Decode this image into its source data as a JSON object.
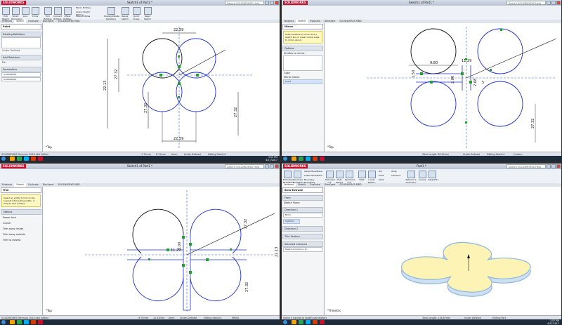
{
  "app": {
    "logo": "SOLIDWORKS",
    "search_placeholder": "Search SOLIDWORKS Help"
  },
  "q1": {
    "title": "Sketch1 of Part1 *",
    "ribbon": [
      "Exit Sketch",
      "Smart Dimension",
      "Line",
      "Circle",
      "Trim Entities",
      "Convert Entities",
      "Offset Entities",
      "Mirror Entities",
      "Linear Sketch Pattern",
      "Move Entities",
      "Display/Delete Relations",
      "Repair Sketch",
      "Quick Snaps",
      "Rapid Sketch"
    ],
    "tabs": [
      "Features",
      "Sketch",
      "Evaluate",
      "DimXpert",
      "SOLIDWORKS MBD"
    ],
    "pm_title": "Point",
    "pm_sections": [
      "Existing Relations",
      "Add Relations",
      "Parameters"
    ],
    "pm_status": "Under Defined",
    "pm_add": "Fix",
    "pm_params": [
      "0.00000000",
      "0.00000000"
    ],
    "dims": {
      "top": "22.59",
      "left_a": "27.32",
      "left_b": "22.13",
      "left_c": "27.32",
      "right": "27.32",
      "bottom": "22.59"
    },
    "status": [
      "SOLIDWORKS Premium 2016 x64 Edition",
      "-1.71mm",
      "8.31mm",
      "0mm",
      "Under Defined",
      "Editing Sketch1"
    ],
    "model_tabs": [
      "Model",
      "3D Views",
      "Motion Study 1"
    ],
    "clock": [
      "3:55 PM",
      "4/17/2017"
    ],
    "axis": "*Top"
  },
  "q2": {
    "title": "Sketch1 of Part1 *",
    "tabs": [
      "Features",
      "Sketch",
      "Evaluate",
      "DimXpert",
      "SOLIDWORKS MBD"
    ],
    "pm_title": "Mirror",
    "pm_msg": "Select entities to mirror and a sketch line or linear model edge to mirror about.",
    "pm_sections": [
      "Options",
      "Entities to mirror:",
      "Copy",
      "Mirror about:"
    ],
    "pm_item": "Line1",
    "dims": {
      "a": "9.80",
      "b": "11.29",
      "c": "2.00",
      "d": "1.50",
      "right": "27.32",
      "mid": "2.68",
      "e": "5"
    },
    "status": [
      "Total Length: 80.92mm",
      "Under Defined",
      "Editing Sketch1",
      "Custom"
    ],
    "model_tabs": [
      "Model",
      "3D Views",
      "Motion Study 1"
    ],
    "axis": "*Top"
  },
  "q3": {
    "title": "Sketch1 of Part1 *",
    "tabs": [
      "Features",
      "Sketch",
      "Evaluate",
      "DimXpert",
      "SOLIDWORKS MBD"
    ],
    "pm_title": "Trim",
    "pm_msg": "Select an entity to trim to the nearest intersecting entity, or drag to trim entities.",
    "pm_sections": [
      "Options"
    ],
    "pm_options": [
      "Power trim",
      "Corner",
      "Trim away inside",
      "Trim away outside",
      "Trim to closest"
    ],
    "dims": {
      "a": "11.29",
      "b": "2.00",
      "c": "27.32",
      "d": "22.13",
      "e": "27.32"
    },
    "status": [
      "SOLIDWORKS Premium 2016 x64 Edition",
      "-9.75mm",
      "12.54mm",
      "0mm",
      "Under Defined",
      "Editing Sketch1",
      "MMGS"
    ],
    "model_tabs": [
      "Model",
      "3D Views",
      "Motion Study 1"
    ],
    "axis": "*Top"
  },
  "q4": {
    "title": "Part1 *",
    "tabs": [
      "Features",
      "Sketch",
      "Evaluate",
      "DimXpert",
      "SOLIDWORKS MBD"
    ],
    "ribbon": [
      "Extruded Boss/Base",
      "Revolved Boss/Base",
      "Swept Boss/Base",
      "Lofted Boss/Base",
      "Boundary Boss/Base",
      "Extruded Cut",
      "Hole Wizard",
      "Revolved Cut",
      "Fillet",
      "Linear Pattern",
      "Rib",
      "Draft",
      "Shell",
      "Wrap",
      "Intersect",
      "Reference Geometry",
      "Curves",
      "Instant3D"
    ],
    "pm_title": "Boss-Extrude",
    "pm_sections": [
      "From",
      "Sketch Plane",
      "Direction 1",
      "Blind",
      "Direction 2",
      "Thin Feature",
      "Selected Contours"
    ],
    "pm_depth": "5.00mm",
    "pm_contour": "Sketch1-Contour<1>",
    "status": [
      "Select a handle to modify parameters",
      "Total Length: 238.87mm",
      "Under Defined",
      "Editing Part"
    ],
    "model_tabs": [
      "Model",
      "3D Views",
      "Motion Study 1"
    ],
    "axis": "*Trimetric",
    "clock": [
      "3:57 PM",
      "4/17/2017"
    ]
  },
  "colors": {
    "sketch_blue": "#1f2fd0",
    "relation_green": "#1fa12a",
    "centerline": "#3466c4",
    "part_face": "#fdf3b5",
    "part_edge": "#8fb8e0",
    "accent_red": "#c8102e"
  }
}
